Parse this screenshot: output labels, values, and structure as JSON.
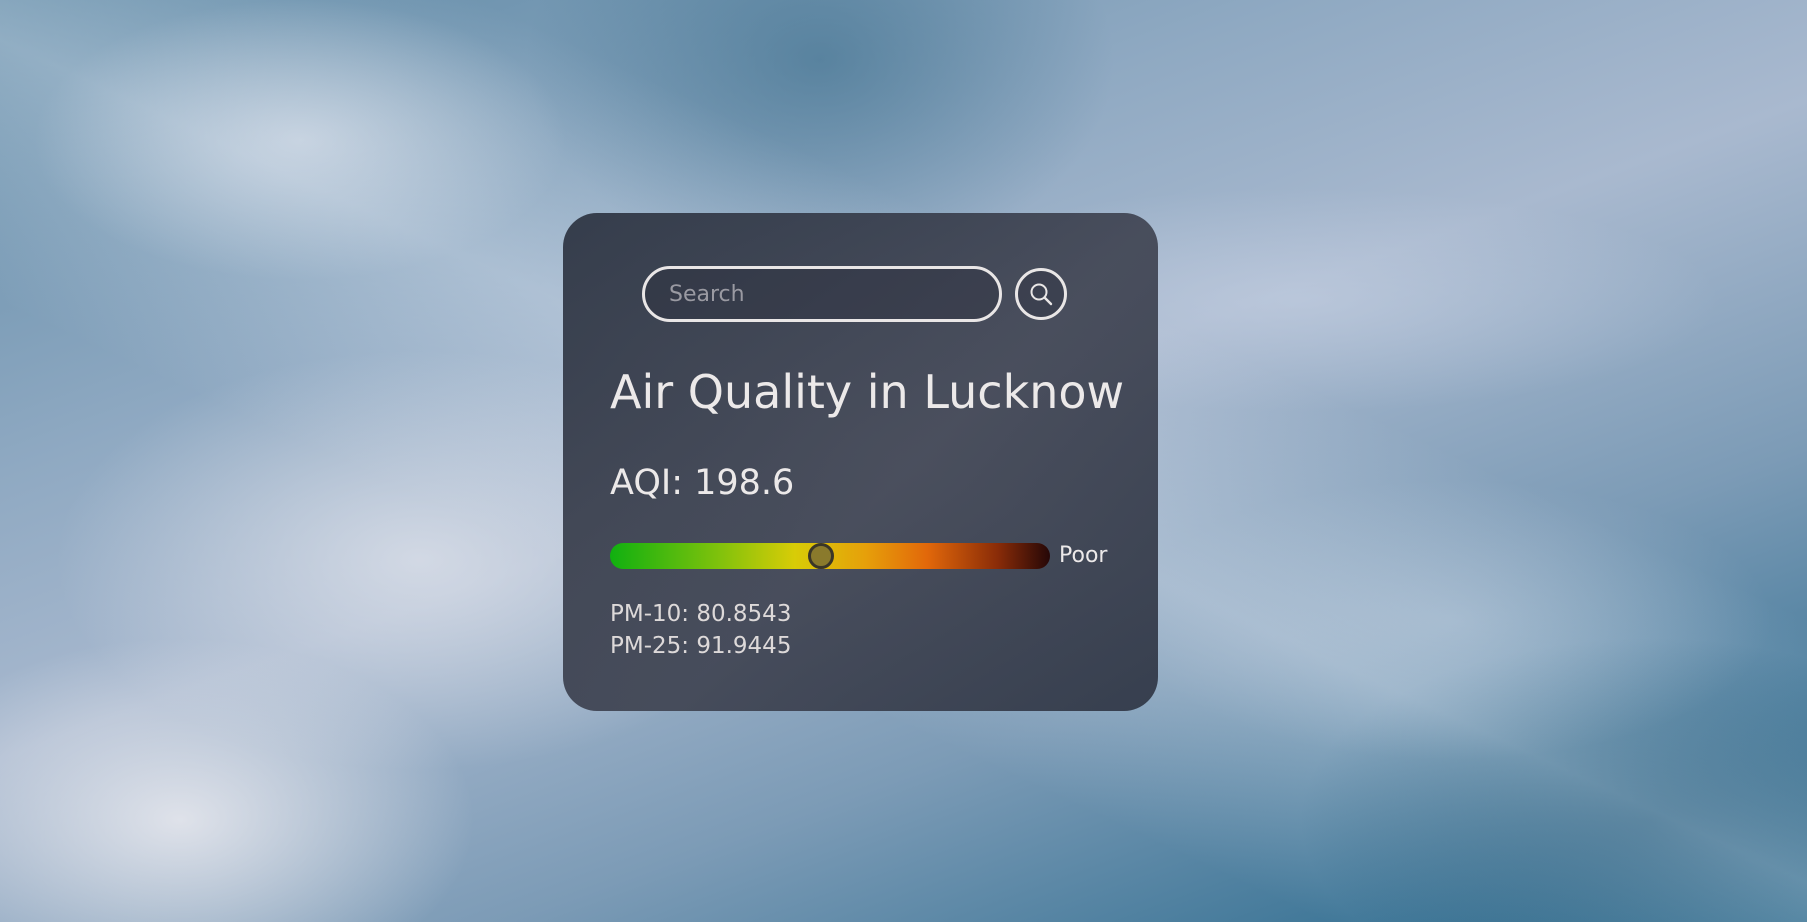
{
  "search": {
    "placeholder": "Search",
    "value": ""
  },
  "title": "Air Quality in Lucknow",
  "aqi": {
    "text": "AQI: 198.6",
    "value": 198.6,
    "level_fraction": 0.48,
    "category": "Poor"
  },
  "pollutants": {
    "pm10": "PM-10: 80.8543",
    "pm25": "PM-25: 91.9445"
  },
  "icons": {
    "search_button": "search-icon"
  },
  "colors": {
    "card": "#3a404e",
    "text": "#ece9e9",
    "bar_green": "#10b010",
    "bar_yellow": "#d8cc07",
    "bar_orange": "#e2680a",
    "bar_dark": "#250707"
  }
}
